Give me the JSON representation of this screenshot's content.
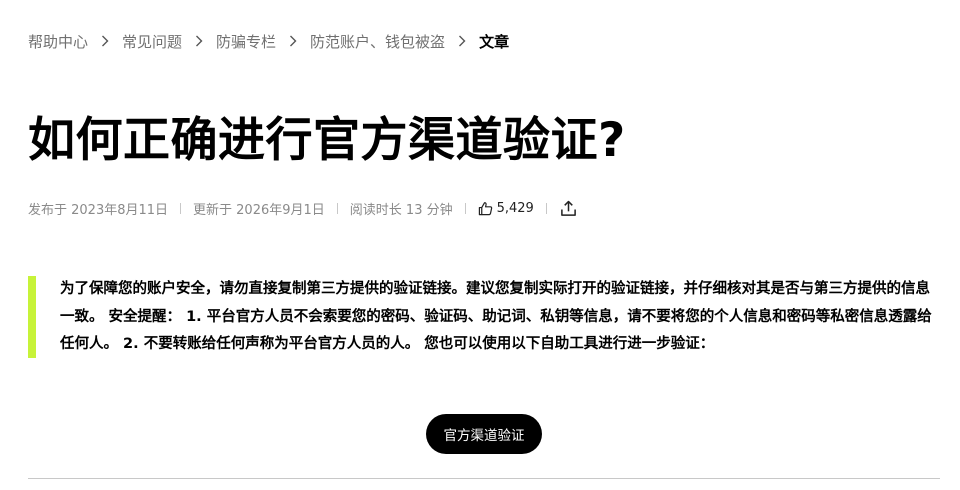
{
  "breadcrumb": {
    "items": [
      {
        "label": "帮助中心"
      },
      {
        "label": "常见问题"
      },
      {
        "label": "防骗专栏"
      },
      {
        "label": "防范账户、钱包被盗"
      },
      {
        "label": "文章"
      }
    ],
    "separator_icon": "chevron-right-icon"
  },
  "article": {
    "title": "如何正确进行官方渠道验证?",
    "meta": {
      "published": "发布于 2023年8月11日",
      "updated": "更新于 2026年9月1日",
      "read_time": "阅读时长 13 分钟",
      "likes": "5,429",
      "like_icon": "thumbs-up-icon",
      "share_icon": "share-icon"
    },
    "notice": {
      "text": "为了保障您的账户安全，请勿直接复制第三方提供的验证链接。建议您复制实际打开的验证链接，并仔细核对其是否与第三方提供的信息一致。 安全提醒： 1. 平台官方人员不会索要您的密码、验证码、助记词、私钥等信息，请不要将您的个人信息和密码等私密信息透露给任何人。 2. 不要转账给任何声称为平台官方人员的人。 您也可以使用以下自助工具进行进一步验证：",
      "accent_color": "#c7f339"
    },
    "verify_button": {
      "label": "官方渠道验证"
    }
  }
}
